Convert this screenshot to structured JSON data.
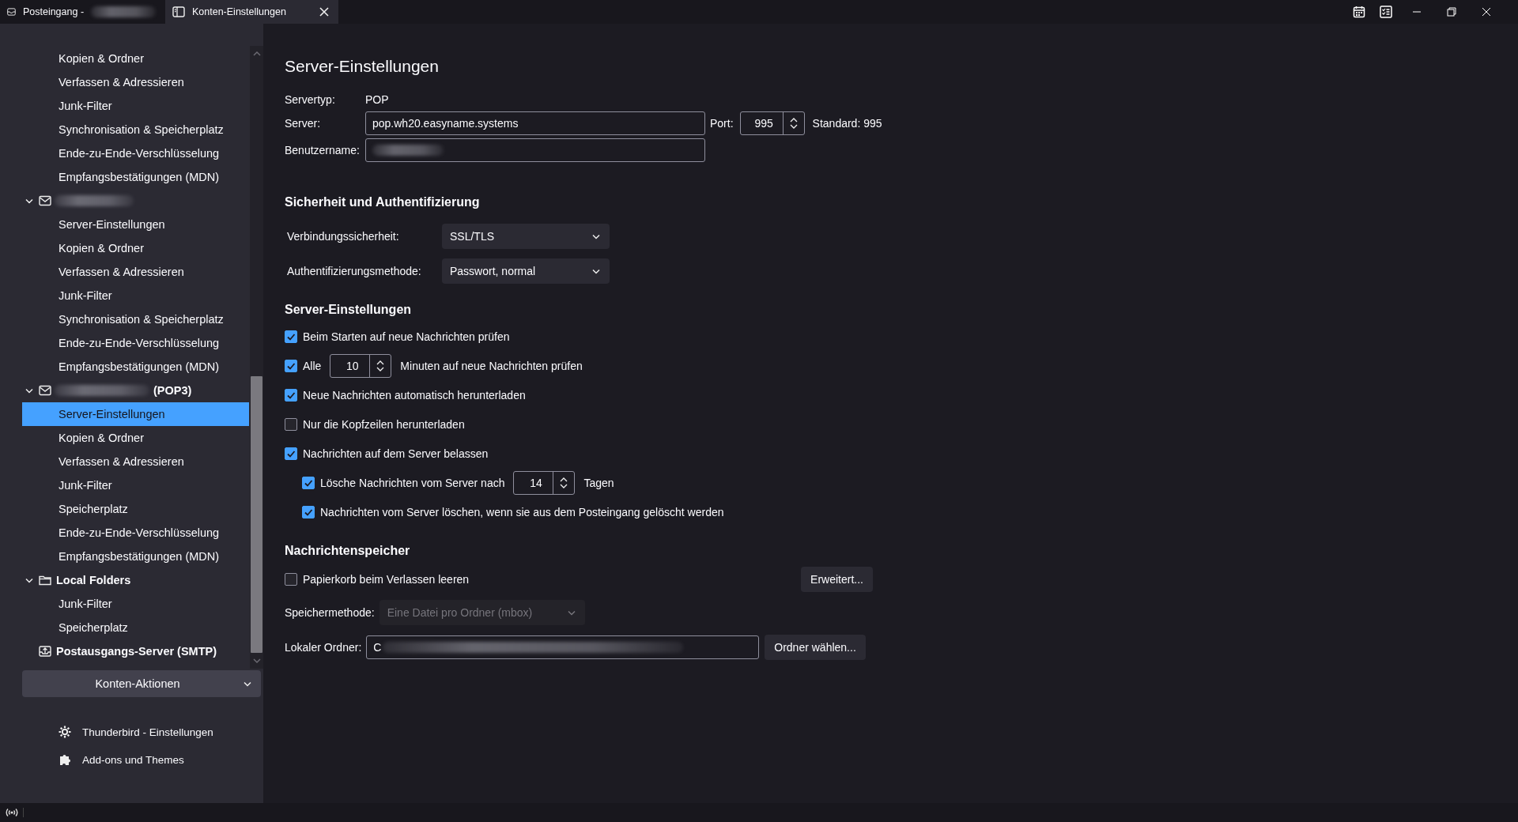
{
  "tabs": [
    {
      "label": "Posteingang -",
      "kind": "inbox",
      "selected": false,
      "redacted": true
    },
    {
      "label": "Konten-Einstellungen",
      "kind": "settings",
      "selected": true,
      "closable": true
    }
  ],
  "sidebar": {
    "tree": [
      {
        "kind": "cut",
        "children": [
          {
            "label": "Kopien & Ordner",
            "selected": false
          },
          {
            "label": "Verfassen & Adressieren",
            "selected": false
          },
          {
            "label": "Junk-Filter",
            "selected": false
          },
          {
            "label": "Synchronisation & Speicherplatz",
            "selected": false
          },
          {
            "label": "Ende-zu-Ende-Verschlüsselung",
            "selected": false
          },
          {
            "label": "Empfangsbestätigungen (MDN)",
            "selected": false
          }
        ]
      },
      {
        "kind": "mail-account",
        "expanded": true,
        "redacted": true,
        "children": [
          {
            "label": "Server-Einstellungen",
            "selected": false
          },
          {
            "label": "Kopien & Ordner",
            "selected": false
          },
          {
            "label": "Verfassen & Adressieren",
            "selected": false
          },
          {
            "label": "Junk-Filter",
            "selected": false
          },
          {
            "label": "Synchronisation & Speicherplatz",
            "selected": false
          },
          {
            "label": "Ende-zu-Ende-Verschlüsselung",
            "selected": false
          },
          {
            "label": "Empfangsbestätigungen (MDN)",
            "selected": false
          }
        ]
      },
      {
        "kind": "mail-account",
        "expanded": true,
        "redacted": true,
        "suffix": "(POP3)",
        "children": [
          {
            "label": "Server-Einstellungen",
            "selected": true
          },
          {
            "label": "Kopien & Ordner",
            "selected": false
          },
          {
            "label": "Verfassen & Adressieren",
            "selected": false
          },
          {
            "label": "Junk-Filter",
            "selected": false
          },
          {
            "label": "Speicherplatz",
            "selected": false
          },
          {
            "label": "Ende-zu-Ende-Verschlüsselung",
            "selected": false
          },
          {
            "label": "Empfangsbestätigungen (MDN)",
            "selected": false
          }
        ]
      },
      {
        "kind": "local-folders",
        "expanded": true,
        "label": "Local Folders",
        "children": [
          {
            "label": "Junk-Filter",
            "selected": false
          },
          {
            "label": "Speicherplatz",
            "selected": false
          }
        ]
      },
      {
        "kind": "outgoing-server",
        "label": "Postausgangs-Server (SMTP)"
      }
    ],
    "actions_button": "Konten-Aktionen",
    "footer_links": [
      {
        "kind": "settings",
        "label": "Thunderbird - Einstellungen"
      },
      {
        "kind": "addons",
        "label": "Add-ons und Themes"
      }
    ]
  },
  "main": {
    "title": "Server-Einstellungen",
    "server_type": {
      "label": "Servertyp:",
      "value": "POP"
    },
    "server": {
      "label": "Server:",
      "value": "pop.wh20.easyname.systems"
    },
    "port": {
      "label": "Port:",
      "value": "995",
      "default": "Standard: 995"
    },
    "username": {
      "label": "Benutzername:",
      "redacted": true
    },
    "security": {
      "heading": "Sicherheit und Authentifizierung",
      "selects": [
        {
          "label": "Verbindungssicherheit:",
          "value": "SSL/TLS",
          "disabled": false
        },
        {
          "label": "Authentifizierungsmethode:",
          "value": "Passwort, normal",
          "disabled": false
        }
      ]
    },
    "server_settings": {
      "heading": "Server-Einstellungen",
      "options": [
        {
          "label": "Beim Starten auf neue Nachrichten prüfen",
          "checked": true
        },
        {
          "label": "Alle",
          "checked": true,
          "spinner": "10",
          "after": "Minuten auf neue Nachrichten prüfen"
        },
        {
          "label": "Neue Nachrichten automatisch herunterladen",
          "checked": true
        },
        {
          "label": "Nur die Kopfzeilen herunterladen",
          "checked": false
        },
        {
          "label": "Nachrichten auf dem Server belassen",
          "checked": true,
          "children": [
            {
              "label": "Lösche Nachrichten vom Server nach",
              "checked": true,
              "spinner": "14",
              "after": "Tagen"
            },
            {
              "label": "Nachrichten vom Server löschen, wenn sie aus dem Posteingang gelöscht werden",
              "checked": true
            }
          ]
        }
      ]
    },
    "storage": {
      "heading": "Nachrichtenspeicher",
      "empty_trash": {
        "label": "Papierkorb beim Verlassen leeren",
        "checked": false
      },
      "advanced_button": "Erweitert...",
      "method": {
        "label": "Speichermethode:",
        "value": "Eine Datei pro Ordner (mbox)",
        "disabled": true
      },
      "local_folder": {
        "label": "Lokaler Ordner:",
        "value": "C",
        "redacted": true,
        "button": "Ordner wählen..."
      }
    }
  }
}
